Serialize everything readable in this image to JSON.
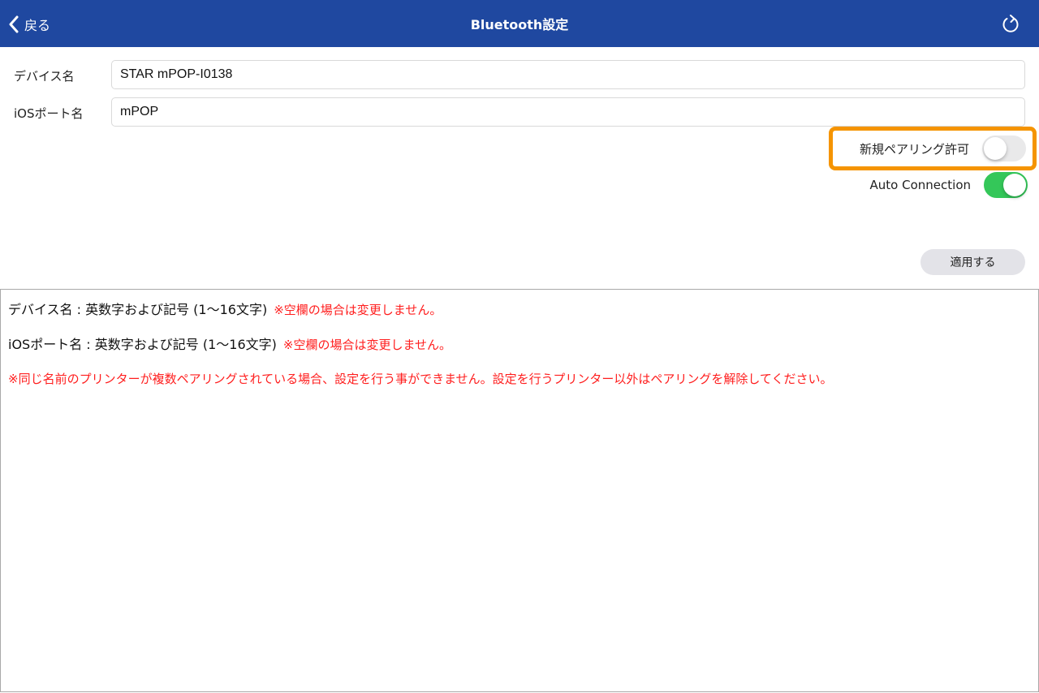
{
  "navbar": {
    "back_label": "戻る",
    "title": "Bluetooth設定",
    "back_icon": "chevron-left-icon",
    "refresh_icon": "refresh-icon",
    "background_color": "#1f48a0"
  },
  "form": {
    "device_name_label": "デバイス名",
    "device_name_value": "STAR mPOP-I0138",
    "ios_port_label": "iOSポート名",
    "ios_port_value": "mPOP"
  },
  "toggles": {
    "new_pairing_label": "新規ペアリング許可",
    "new_pairing_on": false,
    "auto_connection_label": "Auto Connection",
    "auto_connection_on": true,
    "on_color": "#34c759",
    "highlight_color": "#f59400"
  },
  "apply_button_label": "適用する",
  "info": {
    "line1_text": "デバイス名 : 英数字および記号 (1〜16文字)",
    "line1_note": "※空欄の場合は変更しません。",
    "line2_text": "iOSポート名 : 英数字および記号 (1〜16文字)",
    "line2_note": "※空欄の場合は変更しません。",
    "line3_warning": "※同じ名前のプリンターが複数ペアリングされている場合、設定を行う事ができません。設定を行うプリンター以外はペアリングを解除してください。",
    "warning_color": "#ff1e1e"
  }
}
